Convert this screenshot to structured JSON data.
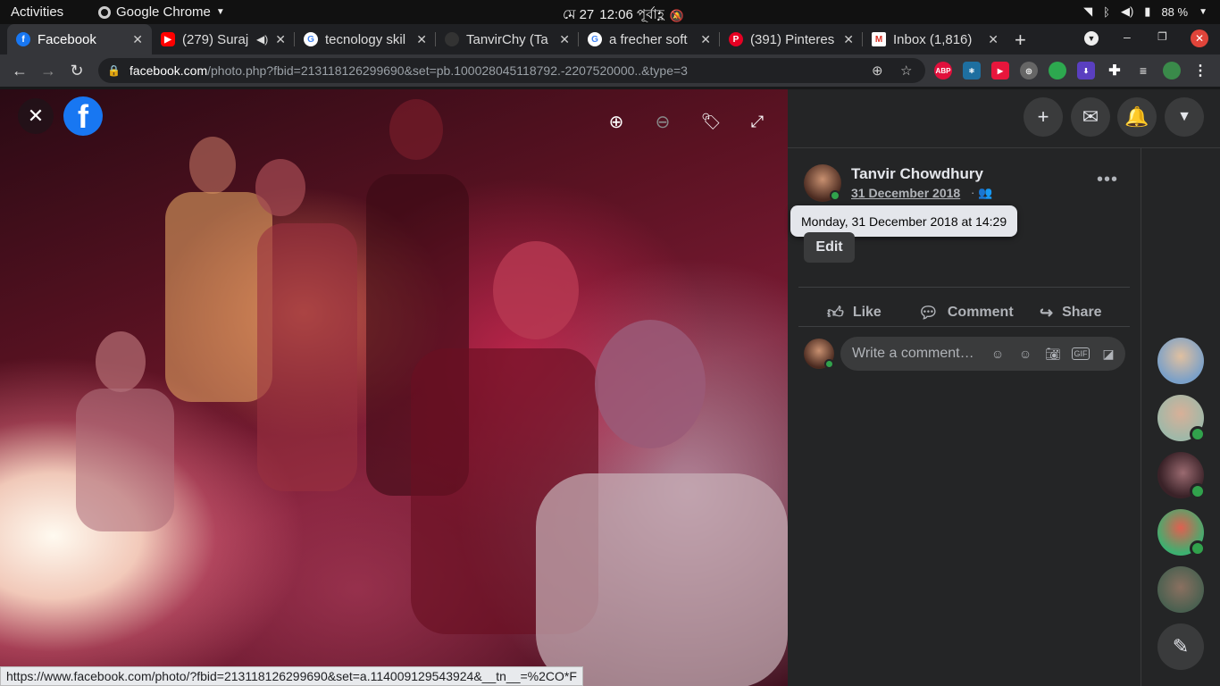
{
  "system_bar": {
    "activities": "Activities",
    "app_name": "Google Chrome",
    "date": "মে 27",
    "time": "12:06 পূর্বাহ্ণ",
    "battery": "88 %"
  },
  "tabs": [
    {
      "title": "Facebook",
      "favicon": "facebook",
      "active": true
    },
    {
      "title": "(279) Suraj",
      "favicon": "youtube",
      "audio": true
    },
    {
      "title": "tecnology skil",
      "favicon": "google"
    },
    {
      "title": "TanvirChy (Ta",
      "favicon": "github"
    },
    {
      "title": "a frecher soft",
      "favicon": "google"
    },
    {
      "title": "(391) Pinteres",
      "favicon": "pinterest"
    },
    {
      "title": "Inbox (1,816)",
      "favicon": "gmail"
    }
  ],
  "address_bar": {
    "domain": "facebook.com",
    "path": "/photo.php?fbid=213118126299690&set=pb.100028045118792.-2207520000..&type=3"
  },
  "extensions": [
    {
      "label": "ABP",
      "color": "#e0103c"
    },
    {
      "label": "",
      "color": "#1e6fa0"
    },
    {
      "label": "",
      "color": "#e8163c"
    },
    {
      "label": "",
      "color": "#888888"
    },
    {
      "label": "",
      "color": "#2da84f"
    },
    {
      "label": "",
      "color": "#5a3fc0"
    }
  ],
  "post": {
    "author": "Tanvir Chowdhury",
    "date": "31 December 2018",
    "tooltip": "Monday, 31 December 2018 at 14:29",
    "edit_label": "Edit",
    "like_label": "Like",
    "comment_label": "Comment",
    "share_label": "Share",
    "comment_placeholder": "Write a comment…"
  },
  "status_url": "https://www.facebook.com/photo/?fbid=213118126299690&set=a.114009129543924&__tn__=%2CO*F",
  "contacts": [
    {
      "color": "#7aa0c8",
      "online": false
    },
    {
      "color": "#9fb8a8",
      "online": true
    },
    {
      "color": "#3a2228",
      "online": true
    },
    {
      "color": "#3db070",
      "online": true
    },
    {
      "color": "#4a6050",
      "online": false
    }
  ]
}
